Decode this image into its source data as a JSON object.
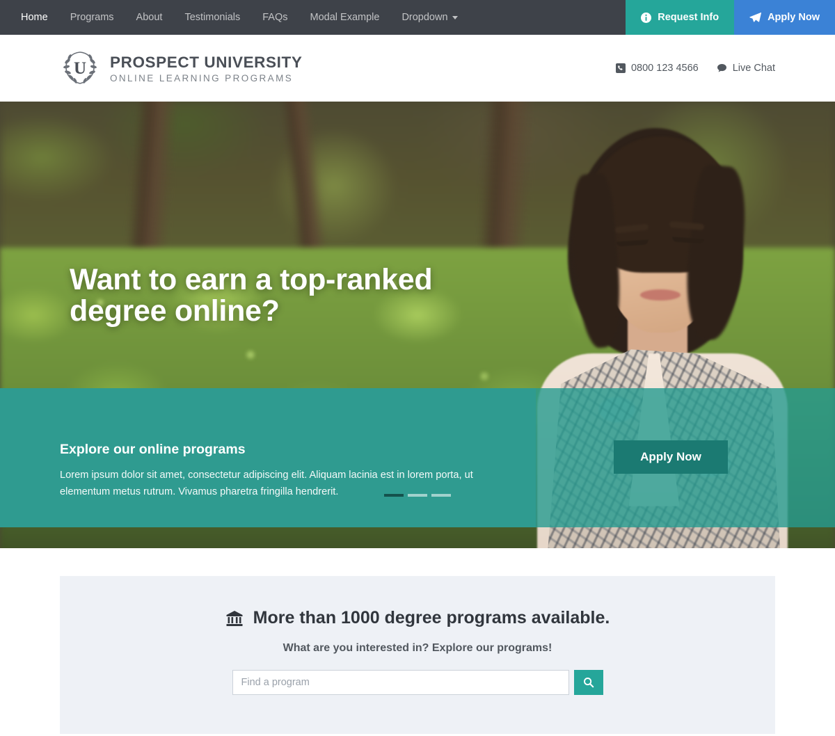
{
  "topnav": {
    "links": [
      {
        "label": "Home",
        "active": true
      },
      {
        "label": "Programs",
        "active": false
      },
      {
        "label": "About",
        "active": false
      },
      {
        "label": "Testimonials",
        "active": false
      },
      {
        "label": "FAQs",
        "active": false
      },
      {
        "label": "Modal Example",
        "active": false
      },
      {
        "label": "Dropdown",
        "active": false,
        "caret": true
      }
    ],
    "request_info_label": "Request Info",
    "request_info_icon": "info-circle-icon",
    "apply_now_label": "Apply Now",
    "apply_now_icon": "paper-plane-icon",
    "colors": {
      "bar": "#3e4249",
      "teal": "#25a69a",
      "blue": "#3b82d6"
    }
  },
  "header": {
    "logo_icon": "laurel-wreath-u-icon",
    "brand_name": "PROSPECT UNIVERSITY",
    "brand_sub": "ONLINE LEARNING PROGRAMS",
    "phone_icon": "phone-square-icon",
    "phone": "0800 123 4566",
    "chat_icon": "comment-icon",
    "chat_label": "Live Chat"
  },
  "hero": {
    "title": "Want to earn a top-ranked degree online?",
    "band_heading": "Explore our online programs",
    "band_text": "Lorem ipsum dolor sit amet, consectetur adipiscing elit. Aliquam lacinia est in lorem porta, ut elementum metus rutrum. Vivamus pharetra fringilla hendrerit.",
    "band_button": "Apply Now",
    "indicators": [
      {
        "active": true
      },
      {
        "active": false
      },
      {
        "active": false
      }
    ],
    "colors": {
      "band": "#2f9b90",
      "button": "#1b7a72",
      "indicator_active": "#14524d"
    }
  },
  "search_panel": {
    "icon": "university-building-icon",
    "heading": "More than 1000 degree programs available.",
    "subheading": "What are you interested in? Explore our programs!",
    "input_placeholder": "Find a program",
    "input_value": "",
    "search_icon": "search-icon",
    "background": "#eef1f6"
  }
}
